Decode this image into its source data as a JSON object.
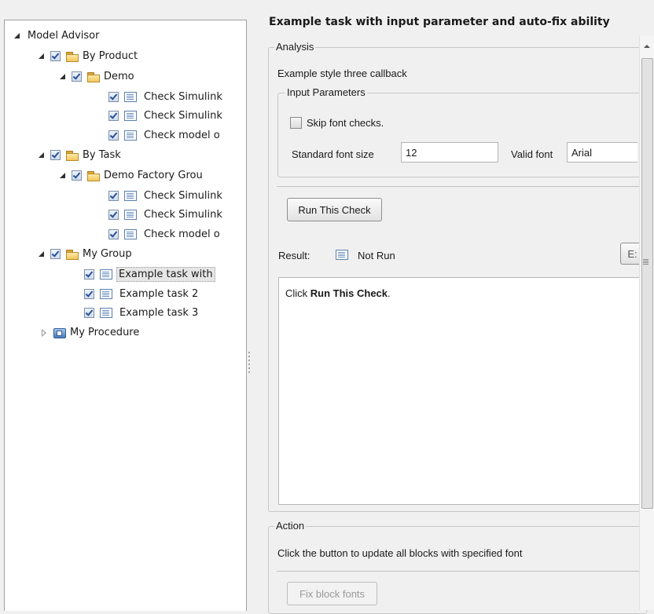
{
  "tree": {
    "root": "Model Advisor",
    "by_product": "By Product",
    "demo": "Demo",
    "check1": "Check Simulink",
    "check2": "Check Simulink",
    "check3": "Check model o",
    "by_task": "By Task",
    "demo_factory": "Demo Factory Grou",
    "check4": "Check Simulink",
    "check5": "Check Simulink",
    "check6": "Check model o",
    "my_group": "My Group",
    "example1": "Example task with",
    "example2": "Example task 2",
    "example3": "Example task 3",
    "my_procedure": "My Procedure"
  },
  "panel": {
    "title": "Example task with input parameter and auto-fix ability",
    "analysis_legend": "Analysis",
    "analysis_desc": "Example style three callback",
    "input_legend": "Input Parameters",
    "skip_label": "Skip font checks.",
    "font_size_label": "Standard font size",
    "font_size_value": "12",
    "valid_font_label": "Valid font",
    "valid_font_value": "Arial",
    "run_button": "Run This Check",
    "result_label": "Result:",
    "result_status": "Not Run",
    "explore_button": "E:",
    "result_text_pre": "Click ",
    "result_text_bold": "Run This Check",
    "result_text_post": ".",
    "action_legend": "Action",
    "action_desc": "Click the button to update all blocks with specified font",
    "fix_button": "Fix block fonts"
  }
}
